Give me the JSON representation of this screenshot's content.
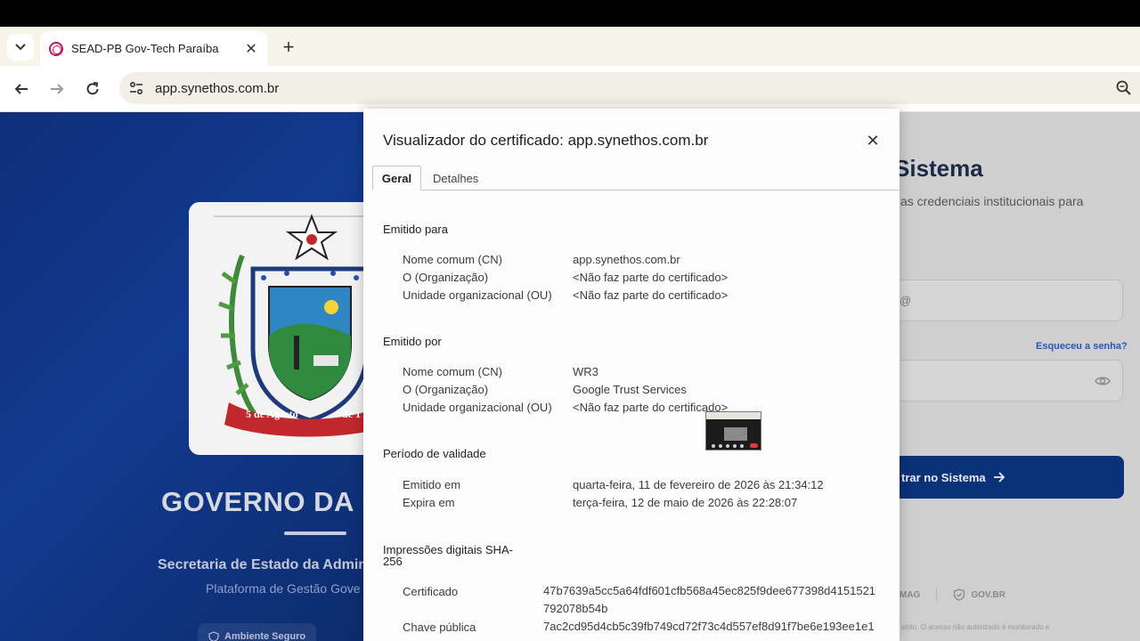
{
  "browser": {
    "tab_title": "SEAD-PB Gov-Tech Paraíba",
    "url": "app.synethos.com.br"
  },
  "page": {
    "gov_title": "GOVERNO DA P",
    "secretaria": "Secretaria de Estado da Admin",
    "plataforma": "Plataforma de Gestão Gove",
    "ambiente": "Ambiente Seguro",
    "crest_ribbon": "5 de Agosto",
    "crest_ribbon_right": "de 1",
    "login_title": "Sistema",
    "login_subtitle": "as credenciais institucionais para",
    "field1_text": "@",
    "forgot_password": "Esqueceu a senha?",
    "submit_label": "trar no Sistema",
    "footer_link_1": "MAG",
    "footer_link_2": "GOV.BR",
    "legal_text": "strito. O acesso não autorizado é monitorado e"
  },
  "dialog": {
    "title": "Visualizador do certificado: app.synethos.com.br",
    "tabs": [
      "Geral",
      "Detalhes"
    ],
    "issued_to": {
      "heading": "Emitido para",
      "rows": [
        {
          "label": "Nome comum (CN)",
          "value": "app.synethos.com.br"
        },
        {
          "label": "O (Organização)",
          "value": "<Não faz parte do certificado>"
        },
        {
          "label": "Unidade organizacional (OU)",
          "value": "<Não faz parte do certificado>"
        }
      ]
    },
    "issued_by": {
      "heading": "Emitido por",
      "rows": [
        {
          "label": "Nome comum (CN)",
          "value": "WR3"
        },
        {
          "label": "O (Organização)",
          "value": "Google Trust Services"
        },
        {
          "label": "Unidade organizacional (OU)",
          "value": "<Não faz parte do certificado>"
        }
      ]
    },
    "validity": {
      "heading": "Período de validade",
      "rows": [
        {
          "label": "Emitido em",
          "value": "quarta-feira, 11 de fevereiro de 2026 às 21:34:12"
        },
        {
          "label": "Expira em",
          "value": "terça-feira, 12 de maio de 2026 às 22:28:07"
        }
      ]
    },
    "fingerprints": {
      "heading": "Impressões digitais SHA-256",
      "rows": [
        {
          "label": "Certificado",
          "value": "47b7639a5cc5a64fdf601cfb568a45ec825f9dee677398d4151521792078b54b"
        },
        {
          "label": "Chave pública",
          "value": "7ac2cd95d4cb5c39fb749cd72f73c4d557ef8d91f7be6e193ee1e1"
        }
      ]
    }
  },
  "colors": {
    "page_blue": "#123a8f",
    "submit_blue": "#0a3278",
    "link_blue": "#2a57b8",
    "tabstrip": "#f7f4e9"
  }
}
